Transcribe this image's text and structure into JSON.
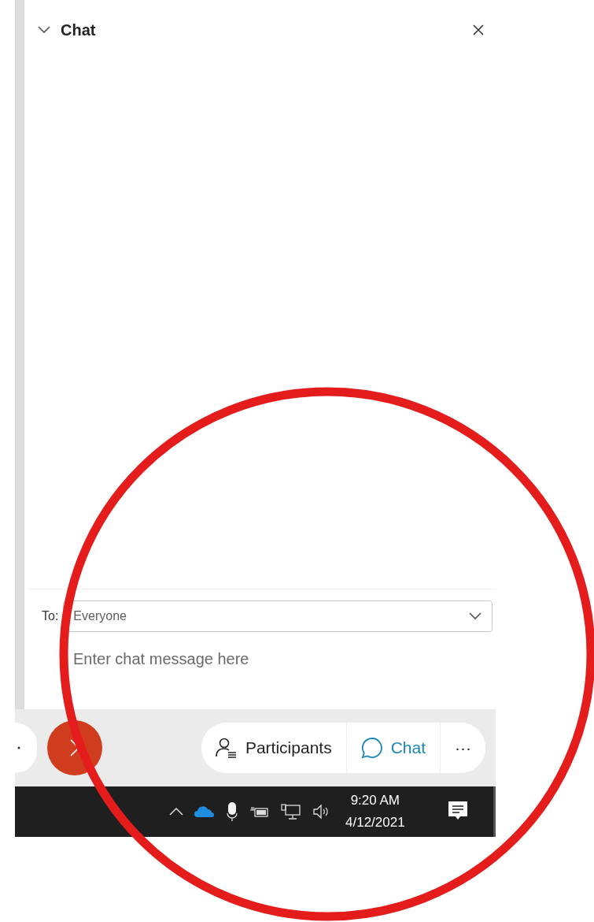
{
  "chat_panel": {
    "title": "Chat",
    "expanded": true,
    "recipient_label": "To:",
    "recipient": "Everyone",
    "message_placeholder": "Enter chat message here"
  },
  "toolbar": {
    "buttons": [
      {
        "kind": "participants",
        "label": "Participants",
        "selected": false
      },
      {
        "kind": "chat",
        "label": "Chat",
        "selected": true
      },
      {
        "kind": "more",
        "label": "···",
        "selected": false
      }
    ]
  },
  "taskbar": {
    "time": "9:20 AM",
    "date": "4/12/2021"
  }
}
